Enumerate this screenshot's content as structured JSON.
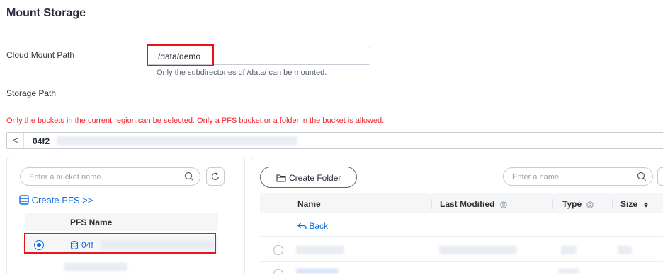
{
  "page": {
    "title": "Mount Storage"
  },
  "form": {
    "cloud_mount_path_label": "Cloud Mount Path",
    "cloud_mount_path_value": "/data/demo",
    "cloud_mount_path_hint": "Only the subdirectories of /data/ can be mounted.",
    "storage_path_label": "Storage Path"
  },
  "warning": "Only the buckets in the current region can be selected. Only a PFS bucket or a folder in the bucket is allowed.",
  "path_bar": {
    "back_glyph": "<",
    "current": "04f2"
  },
  "left_panel": {
    "search_placeholder": "Enter a bucket name.",
    "create_pfs": "Create PFS >>",
    "column_header": "PFS Name",
    "rows": [
      {
        "name": "04f",
        "selected": true
      }
    ]
  },
  "right_panel": {
    "create_folder": "Create Folder",
    "search_placeholder": "Enter a name.",
    "columns": {
      "name": "Name",
      "last_modified": "Last Modified",
      "type": "Type",
      "size": "Size"
    },
    "back_link": "Back"
  },
  "colors": {
    "accent": "#0a6ce0",
    "highlight": "#e8141b",
    "warning": "#f5222d"
  },
  "icons": [
    "chevron-left-icon",
    "search-icon",
    "refresh-icon",
    "bucket-icon",
    "folder-icon",
    "back-arrow-icon",
    "sort-icon"
  ]
}
